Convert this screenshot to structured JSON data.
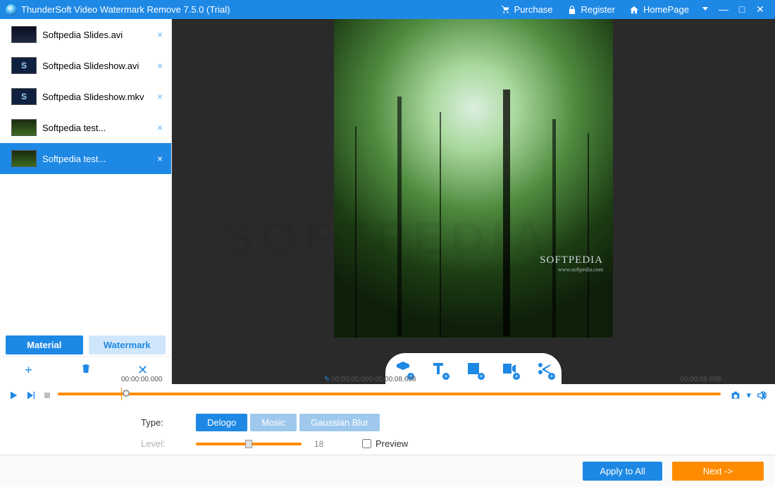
{
  "titlebar": {
    "title": "ThunderSoft Video Watermark Remove 7.5.0 (Trial)",
    "purchase": "Purchase",
    "register": "Register",
    "homepage": "HomePage"
  },
  "sidebar": {
    "files": [
      {
        "name": "Softpedia Slides.avi",
        "thumb": "night",
        "selected": false
      },
      {
        "name": "Softpedia Slideshow.avi",
        "thumb": "slideshow",
        "selected": false
      },
      {
        "name": "Softpedia Slideshow.mkv",
        "thumb": "slideshow",
        "selected": false
      },
      {
        "name": "Softpedia test...",
        "thumb": "forest",
        "selected": false
      },
      {
        "name": "Softpedia test...",
        "thumb": "forest",
        "selected": true
      }
    ],
    "tabs": {
      "material": "Material",
      "watermark": "Watermark",
      "active": "material"
    }
  },
  "preview": {
    "watermark_text": "SOFTPEDIA",
    "watermark_sub": "www.softpedia.com"
  },
  "timeline": {
    "start": "00:00:00.000",
    "range": "00:00:00.000-00:00:08.608",
    "end": "00:00:08.608"
  },
  "options": {
    "type_label": "Type:",
    "types": [
      "Delogo",
      "Mosic",
      "Gaussian Blur"
    ],
    "type_active": 0,
    "level_label": "Level:",
    "level_value": "18",
    "preview_label": "Preview",
    "preview_checked": false
  },
  "footer": {
    "apply": "Apply to All",
    "next": "Next ->"
  },
  "global_watermark": "SOFTPEDIA"
}
